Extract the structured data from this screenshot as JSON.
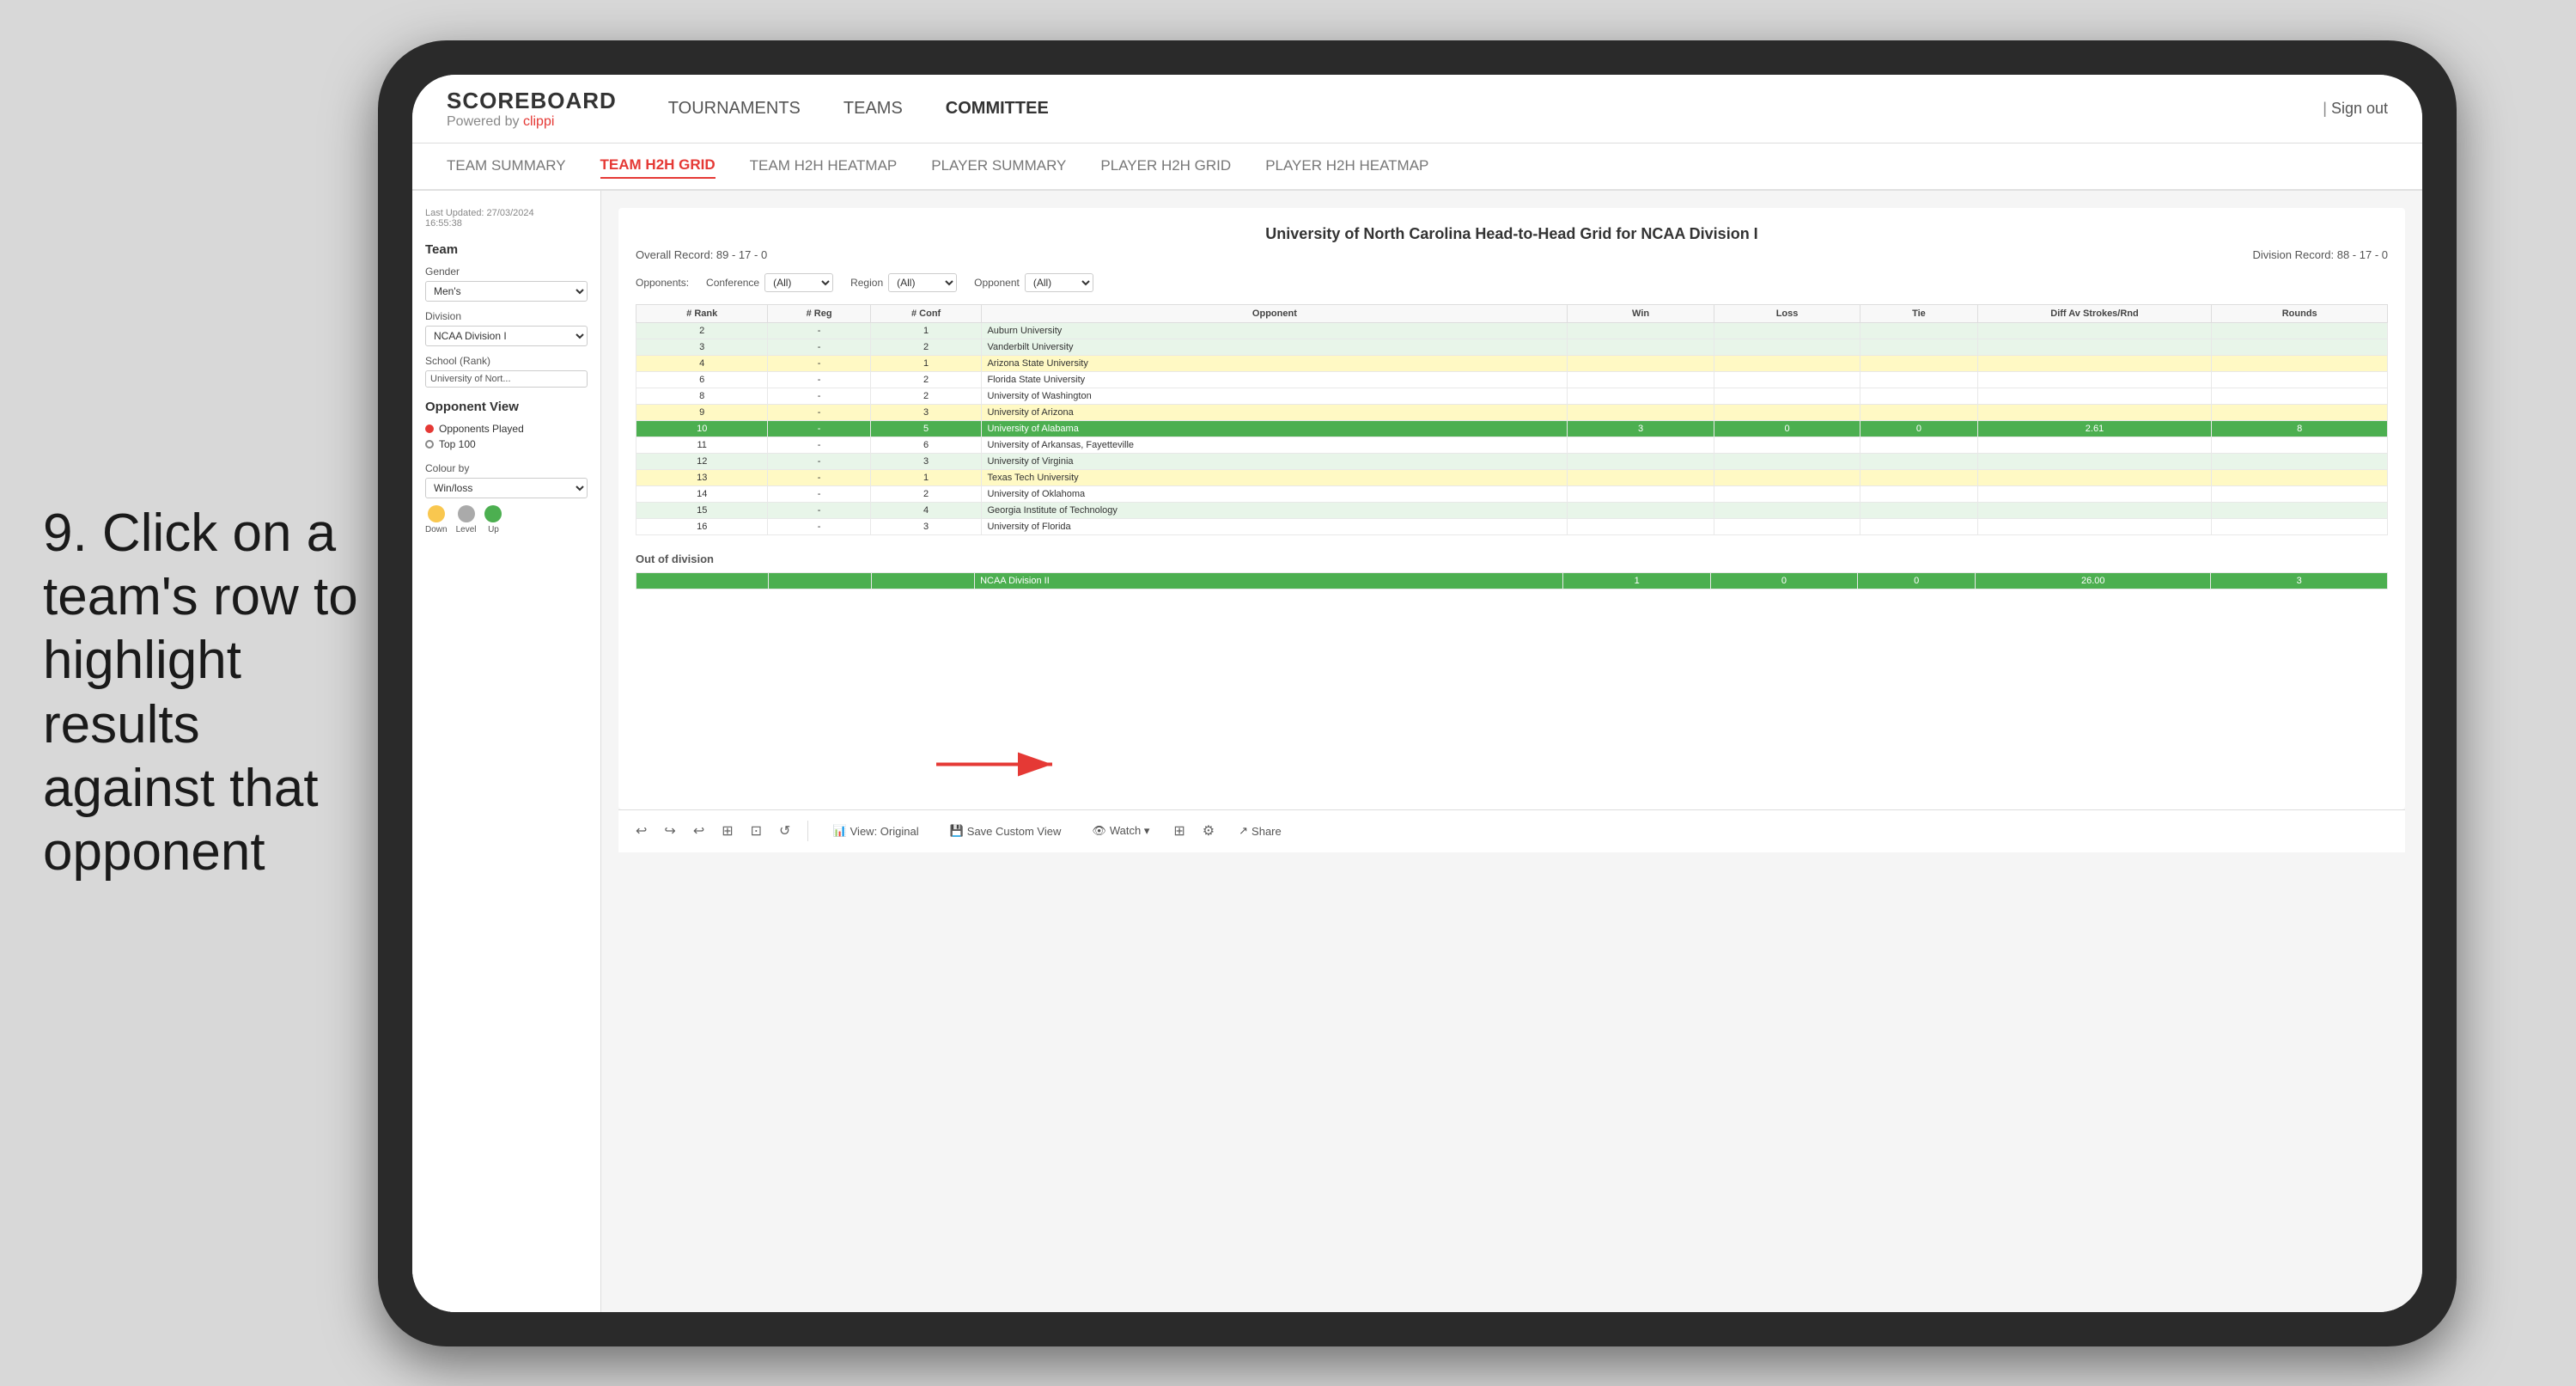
{
  "instruction": {
    "text": "9. Click on a team's row to highlight results against that opponent"
  },
  "nav": {
    "logo": "SCOREBOARD",
    "logo_sub": "Powered by clippi",
    "links": [
      "TOURNAMENTS",
      "TEAMS",
      "COMMITTEE"
    ],
    "active_link": "COMMITTEE",
    "sign_out": "Sign out"
  },
  "sub_nav": {
    "links": [
      "TEAM SUMMARY",
      "TEAM H2H GRID",
      "TEAM H2H HEATMAP",
      "PLAYER SUMMARY",
      "PLAYER H2H GRID",
      "PLAYER H2H HEATMAP"
    ],
    "active": "TEAM H2H GRID"
  },
  "sidebar": {
    "timestamp_label": "Last Updated: 27/03/2024",
    "timestamp_time": "16:55:38",
    "team_label": "Team",
    "gender_label": "Gender",
    "gender_value": "Men's",
    "division_label": "Division",
    "division_value": "NCAA Division I",
    "school_label": "School (Rank)",
    "school_value": "University of Nort...",
    "opponent_view_label": "Opponent View",
    "radio_options": [
      "Opponents Played",
      "Top 100"
    ],
    "selected_radio": "Opponents Played",
    "colour_by_label": "Colour by",
    "colour_value": "Win/loss",
    "legend": [
      {
        "label": "Down",
        "color": "#f9c74f"
      },
      {
        "label": "Level",
        "color": "#aaaaaa"
      },
      {
        "label": "Up",
        "color": "#4caf50"
      }
    ]
  },
  "grid": {
    "title": "University of North Carolina Head-to-Head Grid for NCAA Division I",
    "overall_record": "89 - 17 - 0",
    "division_record": "88 - 17 - 0",
    "filters": {
      "opponents_label": "Opponents:",
      "conference_label": "Conference",
      "conference_value": "(All)",
      "region_label": "Region",
      "region_value": "(All)",
      "opponent_label": "Opponent",
      "opponent_value": "(All)"
    },
    "columns": [
      "# Rank",
      "# Reg",
      "# Conf",
      "Opponent",
      "Win",
      "Loss",
      "Tie",
      "Diff Av Strokes/Rnd",
      "Rounds"
    ],
    "rows": [
      {
        "rank": "2",
        "reg": "-",
        "conf": "1",
        "opponent": "Auburn University",
        "win": "",
        "loss": "",
        "tie": "",
        "diff": "",
        "rounds": "",
        "highlight": false,
        "style": "light-green"
      },
      {
        "rank": "3",
        "reg": "-",
        "conf": "2",
        "opponent": "Vanderbilt University",
        "win": "",
        "loss": "",
        "tie": "",
        "diff": "",
        "rounds": "",
        "highlight": false,
        "style": "light-green"
      },
      {
        "rank": "4",
        "reg": "-",
        "conf": "1",
        "opponent": "Arizona State University",
        "win": "",
        "loss": "",
        "tie": "",
        "diff": "",
        "rounds": "",
        "highlight": false,
        "style": "light-yellow"
      },
      {
        "rank": "6",
        "reg": "-",
        "conf": "2",
        "opponent": "Florida State University",
        "win": "",
        "loss": "",
        "tie": "",
        "diff": "",
        "rounds": "",
        "highlight": false,
        "style": "normal"
      },
      {
        "rank": "8",
        "reg": "-",
        "conf": "2",
        "opponent": "University of Washington",
        "win": "",
        "loss": "",
        "tie": "",
        "diff": "",
        "rounds": "",
        "highlight": false,
        "style": "normal"
      },
      {
        "rank": "9",
        "reg": "-",
        "conf": "3",
        "opponent": "University of Arizona",
        "win": "",
        "loss": "",
        "tie": "",
        "diff": "",
        "rounds": "",
        "highlight": false,
        "style": "light-yellow"
      },
      {
        "rank": "10",
        "reg": "-",
        "conf": "5",
        "opponent": "University of Alabama",
        "win": "3",
        "loss": "0",
        "tie": "0",
        "diff": "2.61",
        "rounds": "8",
        "highlight": true,
        "style": "highlighted"
      },
      {
        "rank": "11",
        "reg": "-",
        "conf": "6",
        "opponent": "University of Arkansas, Fayetteville",
        "win": "",
        "loss": "",
        "tie": "",
        "diff": "",
        "rounds": "",
        "highlight": false,
        "style": "normal"
      },
      {
        "rank": "12",
        "reg": "-",
        "conf": "3",
        "opponent": "University of Virginia",
        "win": "",
        "loss": "",
        "tie": "",
        "diff": "",
        "rounds": "",
        "highlight": false,
        "style": "light-green"
      },
      {
        "rank": "13",
        "reg": "-",
        "conf": "1",
        "opponent": "Texas Tech University",
        "win": "",
        "loss": "",
        "tie": "",
        "diff": "",
        "rounds": "",
        "highlight": false,
        "style": "light-yellow"
      },
      {
        "rank": "14",
        "reg": "-",
        "conf": "2",
        "opponent": "University of Oklahoma",
        "win": "",
        "loss": "",
        "tie": "",
        "diff": "",
        "rounds": "",
        "highlight": false,
        "style": "normal"
      },
      {
        "rank": "15",
        "reg": "-",
        "conf": "4",
        "opponent": "Georgia Institute of Technology",
        "win": "",
        "loss": "",
        "tie": "",
        "diff": "",
        "rounds": "",
        "highlight": false,
        "style": "light-green"
      },
      {
        "rank": "16",
        "reg": "-",
        "conf": "3",
        "opponent": "University of Florida",
        "win": "",
        "loss": "",
        "tie": "",
        "diff": "",
        "rounds": "",
        "highlight": false,
        "style": "normal"
      }
    ],
    "out_of_division_label": "Out of division",
    "out_of_division_row": {
      "label": "NCAA Division II",
      "win": "1",
      "loss": "0",
      "tie": "0",
      "diff": "26.00",
      "rounds": "3",
      "style": "highlighted"
    }
  },
  "toolbar": {
    "buttons": [
      "View: Original",
      "Save Custom View",
      "Watch ▾",
      "Share"
    ]
  }
}
